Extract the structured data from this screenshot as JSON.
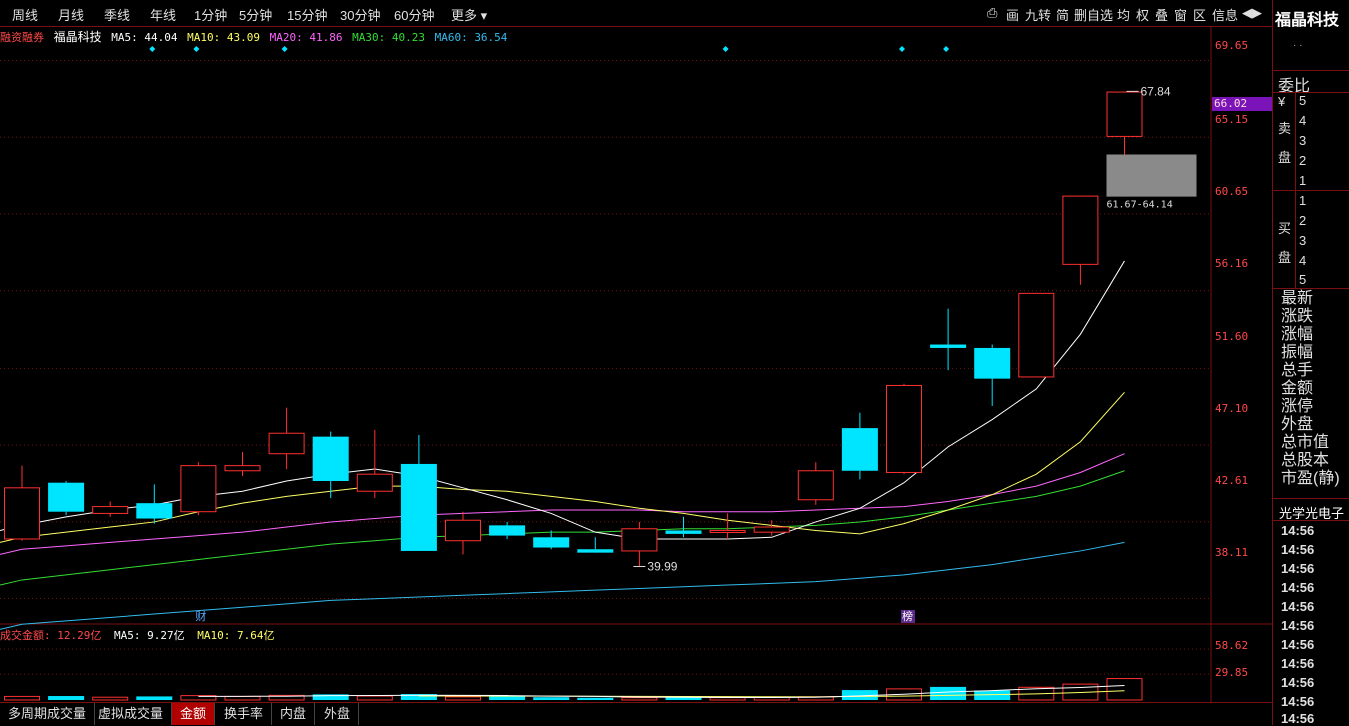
{
  "top_tabs": [
    "周线",
    "月线",
    "季线",
    "年线",
    "1分钟",
    "5分钟",
    "15分钟",
    "30分钟",
    "60分钟",
    "更多 ▾"
  ],
  "top_controls": [
    "⎙",
    "画",
    "九转",
    "简",
    "删自选",
    "均",
    "权",
    "叠",
    "窗",
    "区",
    "信息",
    "◀▶"
  ],
  "indicator": {
    "label": "融资融券",
    "stock": "福晶科技",
    "ma5": "MA5: 44.04",
    "ma10": "MA10: 43.09",
    "ma20": "MA20: 41.86",
    "ma30": "MA30: 40.23",
    "ma60": "MA60: 36.54"
  },
  "colors": {
    "up": "#ff3030",
    "down": "#00e5ff",
    "ma5": "#ffffff",
    "ma10": "#ffff66",
    "ma20": "#ff66ff",
    "ma30": "#33dd33",
    "ma60": "#33bbee",
    "axis": "#ff4a4a",
    "grid": "#7a1010"
  },
  "axis_prices": [
    "69.65",
    "65.15",
    "60.65",
    "56.16",
    "51.60",
    "47.10",
    "42.61",
    "38.11"
  ],
  "current_price_tag": "66.02",
  "annotations": {
    "high": "67.84",
    "low": "39.99",
    "range": "61.67-64.14",
    "cai_marker": "财",
    "bang_marker": "榜"
  },
  "volume_header": {
    "label": "成交金额: ",
    "value": "12.29亿",
    "ma5": "MA5: 9.27亿",
    "ma10": "MA10: 7.64亿"
  },
  "volume_axis": [
    "58.62",
    "29.85"
  ],
  "bottom_tabs": [
    "多周期成交量",
    "虚拟成交量",
    "金额",
    "换手率",
    "内盘",
    "外盘"
  ],
  "bottom_active": "金额",
  "right_panel": {
    "title": "福晶科技",
    "dots": "· ·",
    "weibi": "委比",
    "yuan": "¥",
    "sell_label_1": "卖",
    "sell_label_2": "盘",
    "buy_label_1": "买",
    "buy_label_2": "盘",
    "sell_levels": [
      "5",
      "4",
      "3",
      "2",
      "1"
    ],
    "buy_levels": [
      "1",
      "2",
      "3",
      "4",
      "5"
    ],
    "stats": [
      "最新",
      "涨跌",
      "涨幅",
      "振幅",
      "总手",
      "金额",
      "涨停",
      "外盘",
      "总市值",
      "总股本",
      "市盈(静)"
    ],
    "related": "光学光电子",
    "times": [
      "14:56",
      "14:56",
      "14:56",
      "14:56",
      "14:56",
      "14:56",
      "14:56",
      "14:56",
      "14:56",
      "14:56",
      "14:56"
    ]
  },
  "chart_data": {
    "type": "candlestick",
    "price_range": [
      36.5,
      70.5
    ],
    "candles": [
      {
        "o": 41.6,
        "h": 45.9,
        "l": 41.5,
        "c": 44.6
      },
      {
        "o": 44.9,
        "h": 45.0,
        "l": 43.0,
        "c": 43.2
      },
      {
        "o": 43.1,
        "h": 43.8,
        "l": 42.9,
        "c": 43.5
      },
      {
        "o": 43.7,
        "h": 44.8,
        "l": 42.5,
        "c": 42.8
      },
      {
        "o": 43.2,
        "h": 46.1,
        "l": 43.0,
        "c": 45.9
      },
      {
        "o": 45.6,
        "h": 46.7,
        "l": 45.3,
        "c": 45.9
      },
      {
        "o": 46.6,
        "h": 49.3,
        "l": 45.7,
        "c": 47.8
      },
      {
        "o": 47.6,
        "h": 47.9,
        "l": 44.0,
        "c": 45.0
      },
      {
        "o": 44.4,
        "h": 48.0,
        "l": 44.0,
        "c": 45.4
      },
      {
        "o": 46.0,
        "h": 47.7,
        "l": 40.9,
        "c": 40.9
      },
      {
        "o": 41.5,
        "h": 43.2,
        "l": 40.7,
        "c": 42.7
      },
      {
        "o": 42.4,
        "h": 42.6,
        "l": 41.6,
        "c": 41.8
      },
      {
        "o": 41.7,
        "h": 42.1,
        "l": 41.0,
        "c": 41.1
      },
      {
        "o": 41.0,
        "h": 41.7,
        "l": 40.9,
        "c": 40.8
      },
      {
        "o": 40.9,
        "h": 42.6,
        "l": 39.99,
        "c": 42.2
      },
      {
        "o": 42.1,
        "h": 42.9,
        "l": 41.7,
        "c": 41.9
      },
      {
        "o": 42.0,
        "h": 43.1,
        "l": 41.6,
        "c": 42.1
      },
      {
        "o": 42.0,
        "h": 42.7,
        "l": 41.8,
        "c": 42.3
      },
      {
        "o": 43.9,
        "h": 46.1,
        "l": 43.6,
        "c": 45.6
      },
      {
        "o": 48.1,
        "h": 49.0,
        "l": 45.1,
        "c": 45.6
      },
      {
        "o": 45.5,
        "h": 50.7,
        "l": 45.4,
        "c": 50.6
      },
      {
        "o": 53.0,
        "h": 55.1,
        "l": 51.5,
        "c": 52.8
      },
      {
        "o": 52.8,
        "h": 53.0,
        "l": 49.4,
        "c": 51.0
      },
      {
        "o": 51.1,
        "h": 56.0,
        "l": 51.1,
        "c": 56.0
      },
      {
        "o": 57.7,
        "h": 61.7,
        "l": 56.5,
        "c": 61.7
      },
      {
        "o": 65.2,
        "h": 67.84,
        "l": 61.67,
        "c": 67.8
      }
    ],
    "ma5": [
      42.4,
      42.9,
      43.3,
      43.6,
      44.1,
      44.4,
      45.0,
      45.4,
      45.7,
      45.3,
      44.6,
      43.9,
      43.1,
      42.0,
      41.6,
      41.6,
      41.6,
      41.7,
      42.6,
      43.4,
      44.9,
      47.0,
      48.6,
      50.4,
      53.6,
      57.9
    ],
    "ma10": [
      41.7,
      42.0,
      42.3,
      42.6,
      43.2,
      43.7,
      44.1,
      44.4,
      44.7,
      44.7,
      44.5,
      44.4,
      44.1,
      43.8,
      43.4,
      43.1,
      42.7,
      42.4,
      42.1,
      41.9,
      42.5,
      43.3,
      44.2,
      45.4,
      47.3,
      50.2
    ],
    "ma20": [
      41.0,
      41.2,
      41.4,
      41.6,
      41.8,
      42.0,
      42.3,
      42.6,
      42.8,
      43.0,
      43.1,
      43.2,
      43.3,
      43.3,
      43.3,
      43.2,
      43.2,
      43.2,
      43.3,
      43.4,
      43.5,
      43.8,
      44.2,
      44.7,
      45.5,
      46.6
    ],
    "ma30": [
      39.2,
      39.5,
      39.8,
      40.1,
      40.4,
      40.7,
      41.0,
      41.3,
      41.5,
      41.7,
      41.8,
      41.9,
      42.0,
      42.0,
      42.1,
      42.2,
      42.2,
      42.3,
      42.4,
      42.6,
      42.9,
      43.3,
      43.7,
      44.1,
      44.7,
      45.6
    ],
    "ma60": [
      36.6,
      36.8,
      37.0,
      37.2,
      37.4,
      37.6,
      37.8,
      38.0,
      38.1,
      38.2,
      38.3,
      38.4,
      38.5,
      38.6,
      38.7,
      38.8,
      38.9,
      39.0,
      39.1,
      39.3,
      39.5,
      39.8,
      40.1,
      40.5,
      40.9,
      41.4
    ],
    "volume_range": [
      0,
      68
    ],
    "volume": [
      4.5,
      5.0,
      3.5,
      4.5,
      5.5,
      4.5,
      5.8,
      7.1,
      5.0,
      7.5,
      4.0,
      4.5,
      3.5,
      2.8,
      3.0,
      3.8,
      3.0,
      3.5,
      4.0,
      12.5,
      14.0,
      16.5,
      12.0,
      16.0,
      20.0,
      27.0
    ],
    "vol_ma5": [
      null,
      null,
      null,
      null,
      4.6,
      4.6,
      4.8,
      5.5,
      5.6,
      6.0,
      5.9,
      5.6,
      4.9,
      4.5,
      3.6,
      3.5,
      3.2,
      3.2,
      3.5,
      5.2,
      7.3,
      10.1,
      11.8,
      14.2,
      15.7,
      18.3
    ],
    "vol_ma10": [
      null,
      null,
      null,
      null,
      null,
      null,
      null,
      null,
      null,
      5.1,
      5.0,
      4.9,
      4.9,
      4.7,
      4.5,
      4.4,
      4.3,
      4.1,
      4.0,
      4.5,
      4.9,
      5.9,
      6.8,
      7.7,
      9.4,
      11.7
    ]
  }
}
